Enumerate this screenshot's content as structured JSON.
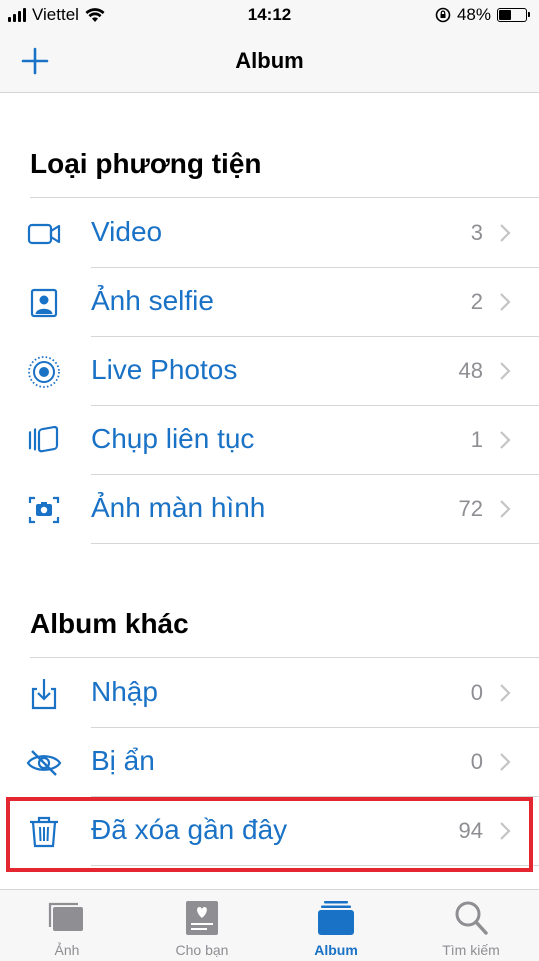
{
  "status_bar": {
    "carrier": "Viettel",
    "time": "14:12",
    "battery": "48%",
    "battery_level": 0.48
  },
  "nav": {
    "title": "Album",
    "add_icon": "plus-icon"
  },
  "sections": [
    {
      "title": "Loại phương tiện",
      "items": [
        {
          "label": "Video",
          "count": "3",
          "icon": "video-icon"
        },
        {
          "label": "Ảnh selfie",
          "count": "2",
          "icon": "selfie-icon"
        },
        {
          "label": "Live Photos",
          "count": "48",
          "icon": "live-photos-icon"
        },
        {
          "label": "Chụp liên tục",
          "count": "1",
          "icon": "burst-icon"
        },
        {
          "label": "Ảnh màn hình",
          "count": "72",
          "icon": "screenshot-icon"
        }
      ]
    },
    {
      "title": "Album khác",
      "items": [
        {
          "label": "Nhập",
          "count": "0",
          "icon": "import-icon"
        },
        {
          "label": "Bị ẩn",
          "count": "0",
          "icon": "hidden-icon"
        },
        {
          "label": "Đã xóa gần đây",
          "count": "94",
          "icon": "trash-icon"
        }
      ]
    }
  ],
  "tabs": [
    {
      "label": "Ảnh",
      "icon": "photos-tab-icon",
      "active": false
    },
    {
      "label": "Cho bạn",
      "icon": "for-you-tab-icon",
      "active": false
    },
    {
      "label": "Album",
      "icon": "albums-tab-icon",
      "active": true
    },
    {
      "label": "Tìm kiếm",
      "icon": "search-tab-icon",
      "active": false
    }
  ],
  "colors": {
    "accent": "#1a72c6",
    "highlight": "#e3262f",
    "secondary_text": "#8e8e93"
  }
}
